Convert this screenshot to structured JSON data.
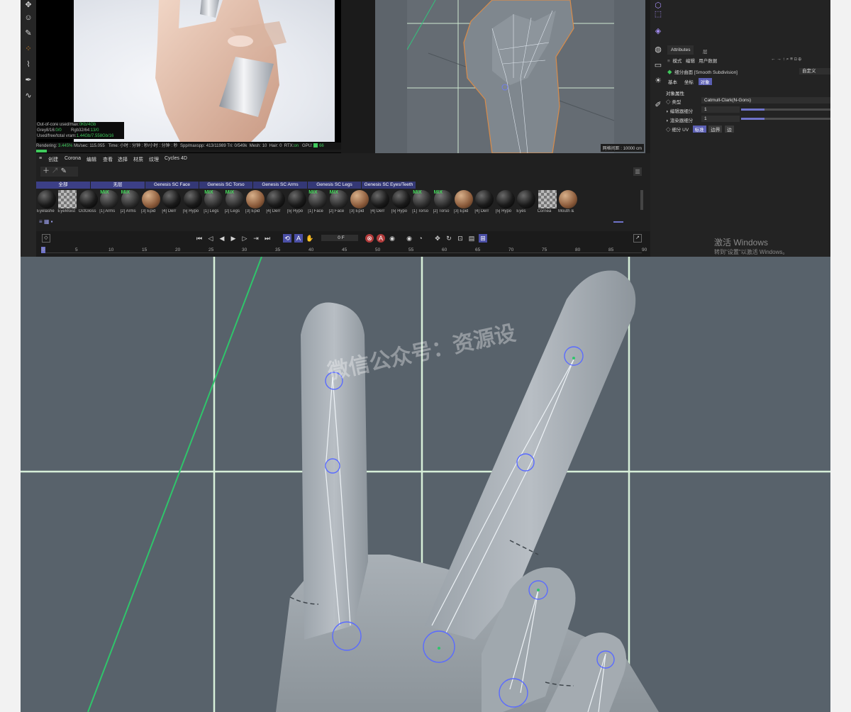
{
  "render": {
    "stats": [
      {
        "label": "Out-of-core used/max:",
        "value": "0Kb/4Gb"
      },
      {
        "label": "Grey8/16:",
        "value": "0/0",
        "label2": "Rgb32/64:",
        "value2": "13/0"
      },
      {
        "label": "Used/free/total vram:",
        "value": "1.44Gb/7.558Gb/16"
      }
    ],
    "status": {
      "rendering_label": "Rendering:",
      "rendering_value": "3.445%",
      "ms_label": "Ms/sec:",
      "ms_value": "115.055",
      "time_label": "Time:",
      "time_value": "小时 : 分钟 : 秒/小时 : 分钟 : 秒",
      "spp_label": "Spp/maxspp:",
      "spp_value": "413/11989",
      "tri_label": "Tri:",
      "tri_value": "0/549k",
      "mesh_label": "Mesh:",
      "mesh_value": "10",
      "hair_label": "Hair:",
      "hair_value": "0",
      "rtx_label": "RTX:",
      "rtx_value": "on",
      "gpu_label": "GPU:",
      "gpu_value": "66"
    },
    "progress": 0.034
  },
  "viewport": {
    "grid_info": "网格间距 : 10000 cm"
  },
  "attributes": {
    "tabs": [
      "Attributes",
      "层"
    ],
    "toolbar": [
      "模式",
      "编辑",
      "用户数据"
    ],
    "object_title": "细分曲面 [Smooth Subdivision]",
    "custom_label": "自定义",
    "subtabs": [
      "基本",
      "坐标",
      "对象"
    ],
    "section_title": "对象属性",
    "type_label": "类型",
    "type_value": "Catmull-Clark(N-Gons)",
    "editor_sub_label": "编辑器细分",
    "editor_sub_value": "1",
    "render_sub_label": "渲染器细分",
    "render_sub_value": "1",
    "uv_label": "细分 UV",
    "uv_options": [
      "标准",
      "边界",
      "边"
    ]
  },
  "windows_notice": {
    "line1": "激活 Windows",
    "line2": "转到\"设置\"以激活 Windows。"
  },
  "material_manager": {
    "menu": [
      "创建",
      "Corona",
      "编辑",
      "查看",
      "选择",
      "材质",
      "纹理",
      "Cycles 4D"
    ],
    "layer_tabs": [
      "全部",
      "无层",
      "Genesis SC Face",
      "Genesis SC Torso",
      "Genesis SC Arms",
      "Genesis SC Legs",
      "Genesis SC Eyes/Teeth"
    ],
    "materials": [
      {
        "name": "Eyelashe",
        "kind": "dark"
      },
      {
        "name": "EyeMoist",
        "kind": "checker"
      },
      {
        "name": "OctGloss",
        "kind": "dark"
      },
      {
        "name": "[1] Arms",
        "kind": "mix"
      },
      {
        "name": "[2] Arms",
        "kind": "mix"
      },
      {
        "name": "[3] Epid",
        "kind": "skin"
      },
      {
        "name": "[4] Derr",
        "kind": "dark"
      },
      {
        "name": "[5] Hypo",
        "kind": "dark"
      },
      {
        "name": "[1] Legs",
        "kind": "mix"
      },
      {
        "name": "[2] Legs",
        "kind": "mix"
      },
      {
        "name": "[3] Epid",
        "kind": "skin"
      },
      {
        "name": "[4] Derr",
        "kind": "dark"
      },
      {
        "name": "[5] Hypo",
        "kind": "dark"
      },
      {
        "name": "[1] Face",
        "kind": "mix"
      },
      {
        "name": "[2] Face",
        "kind": "mix"
      },
      {
        "name": "[3] Epid",
        "kind": "skin"
      },
      {
        "name": "[4] Derr",
        "kind": "dark"
      },
      {
        "name": "[5] Hypo",
        "kind": "dark"
      },
      {
        "name": "[1] Torso",
        "kind": "mix"
      },
      {
        "name": "[2] Torso",
        "kind": "mix"
      },
      {
        "name": "[3] Epid",
        "kind": "skin"
      },
      {
        "name": "[4] Derr",
        "kind": "dark"
      },
      {
        "name": "[5] Hypo",
        "kind": "dark"
      },
      {
        "name": "Eyes",
        "kind": "dark"
      },
      {
        "name": "Cornea",
        "kind": "checker"
      },
      {
        "name": "Mouth &",
        "kind": "skin"
      }
    ],
    "mix_label": "MIX"
  },
  "timeline": {
    "frame": "0 F",
    "ticks": [
      "0",
      "5",
      "10",
      "15",
      "20",
      "25",
      "30",
      "35",
      "40",
      "45",
      "50",
      "55",
      "60",
      "65",
      "70",
      "75",
      "80",
      "85",
      "90"
    ]
  },
  "closeup": {
    "watermark": "微信公众号：资源设"
  },
  "colors": {
    "accent": "#5b5fb3",
    "render_green": "#3fc95c",
    "viewport_bg": "#656c73",
    "closeup_bg": "#58626b",
    "icon_purple": "#a58ef3"
  }
}
